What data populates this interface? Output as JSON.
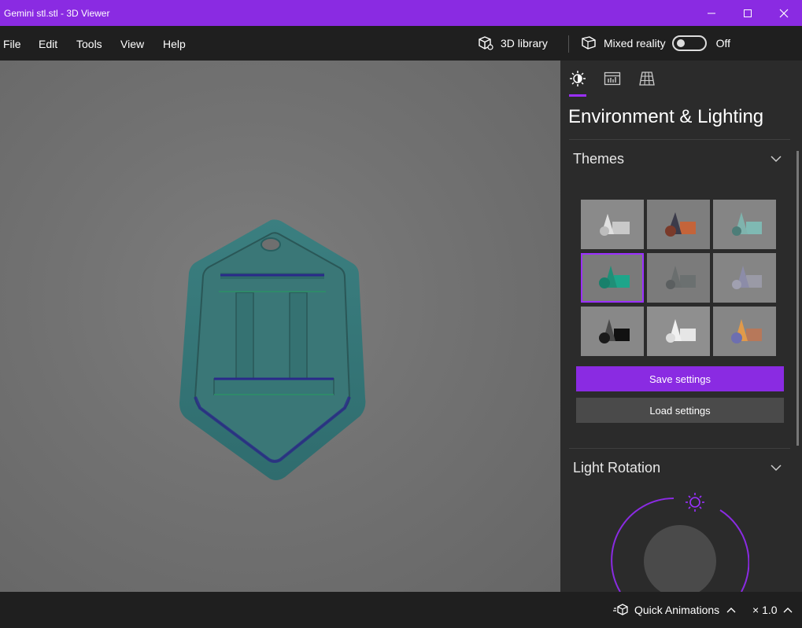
{
  "window": {
    "title": "Gemini stl.stl - 3D Viewer",
    "minimize_icon": "minimize-icon",
    "maximize_icon": "maximize-icon",
    "close_icon": "close-icon"
  },
  "menu": {
    "items": [
      "File",
      "Edit",
      "Tools",
      "View",
      "Help"
    ],
    "library_label": "3D library",
    "mixed_reality_label": "Mixed reality",
    "mixed_reality_state": "Off"
  },
  "panel": {
    "tabs": [
      "lighting-icon",
      "stats-icon",
      "grid-icon"
    ],
    "title": "Environment & Lighting",
    "themes_label": "Themes",
    "save_label": "Save settings",
    "load_label": "Load settings",
    "light_rotation_label": "Light Rotation",
    "accent_color": "#8a2be2"
  },
  "bottom": {
    "quick_animations_label": "Quick Animations",
    "speed_label": "× 1.0"
  }
}
